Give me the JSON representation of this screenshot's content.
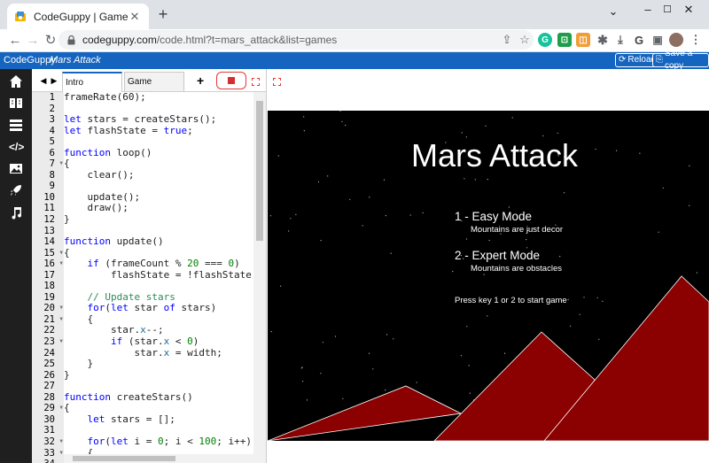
{
  "browser": {
    "tab_title": "CodeGuppy | Game",
    "tab_close": "✕",
    "new_tab": "+",
    "window_controls": {
      "minimize": "–",
      "maximize": "☐",
      "close": "✕"
    },
    "url_host": "codeguppy.com",
    "url_path": "/code.html?t=mars_attack&list=games",
    "extensions": [
      {
        "name": "grammarly-extension",
        "label": "G",
        "color": "#15c39a"
      },
      {
        "name": "green-extension",
        "label": "⊡",
        "color": "#1e9e4a"
      },
      {
        "name": "orange-extension",
        "label": "◫",
        "color": "#f29d38"
      },
      {
        "name": "g-extension",
        "label": "G",
        "color": "#444444"
      }
    ]
  },
  "app": {
    "brand": "CodeGuppy",
    "project": "Mars Attack",
    "reload_label": "Reload",
    "save_label": "Save a copy"
  },
  "editor": {
    "tabs": [
      {
        "label": "Intro",
        "active": true
      },
      {
        "label": "Game",
        "active": false
      }
    ],
    "add_label": "+",
    "line_numbers": [
      "1",
      "2",
      "3",
      "4",
      "5",
      "6",
      "7",
      "8",
      "9",
      "10",
      "11",
      "12",
      "13",
      "14",
      "15",
      "16",
      "17",
      "18",
      "19",
      "20",
      "21",
      "22",
      "23",
      "24",
      "25",
      "26",
      "27",
      "28",
      "29",
      "30",
      "31",
      "32",
      "33",
      "34"
    ],
    "fold_lines": [
      7,
      15,
      16,
      20,
      21,
      23,
      29,
      32,
      33
    ],
    "code_lines": [
      "frameRate(60);",
      "",
      "let stars = createStars();",
      "let flashState = true;",
      "",
      "function loop()",
      "{",
      "    clear();",
      "",
      "    update();",
      "    draw();",
      "}",
      "",
      "function update()",
      "{",
      "    if (frameCount % 20 === 0)",
      "        flashState = !flashState;",
      "",
      "    // Update stars",
      "    for(let star of stars)",
      "    {",
      "        star.x--;",
      "        if (star.x < 0)",
      "            star.x = width;",
      "    }",
      "}",
      "",
      "function createStars()",
      "{",
      "    let stars = [];",
      "",
      "    for(let i = 0; i < 100; i++)",
      "    {",
      ""
    ]
  },
  "game": {
    "title": "Mars Attack",
    "easy_mode": "1 - Easy Mode",
    "easy_desc": "Mountains are just decor",
    "expert_mode": "2 - Expert Mode",
    "expert_desc": "Mountains are obstacles",
    "prompt": "Press key 1 or 2 to start game",
    "colors": {
      "sky": "#000000",
      "mountain": "#8b0000",
      "mountain_outline": "#ffffff"
    }
  }
}
